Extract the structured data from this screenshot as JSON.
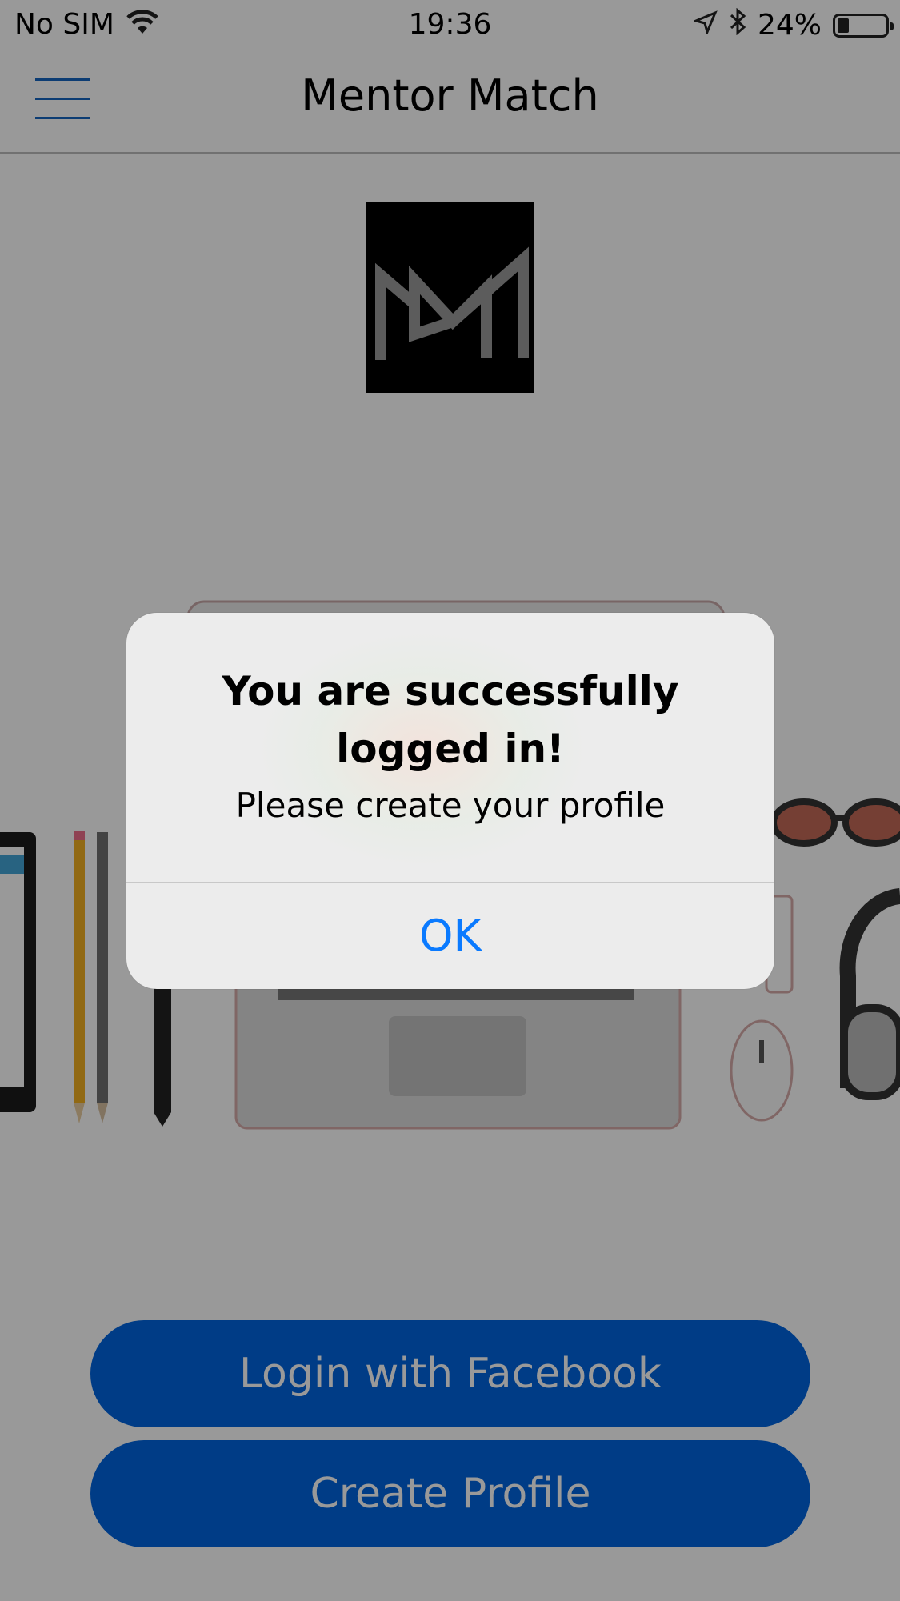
{
  "status_bar": {
    "carrier": "No SIM",
    "time": "19:36",
    "battery": "24%",
    "icons": [
      "wifi-icon",
      "location-arrow-icon",
      "bluetooth-icon",
      "battery-icon"
    ]
  },
  "nav": {
    "title": "Mentor Match",
    "menu_icon": "hamburger-menu-icon"
  },
  "buttons": {
    "facebook": "Login with Facebook",
    "create_profile": "Create Profile"
  },
  "alert": {
    "title": "You are successfully logged in!",
    "message": "Please create your profile",
    "ok": "OK"
  },
  "colors": {
    "accent": "#0a7aff",
    "primary_button": "#0064e0",
    "menu_icon": "#1565c0"
  }
}
